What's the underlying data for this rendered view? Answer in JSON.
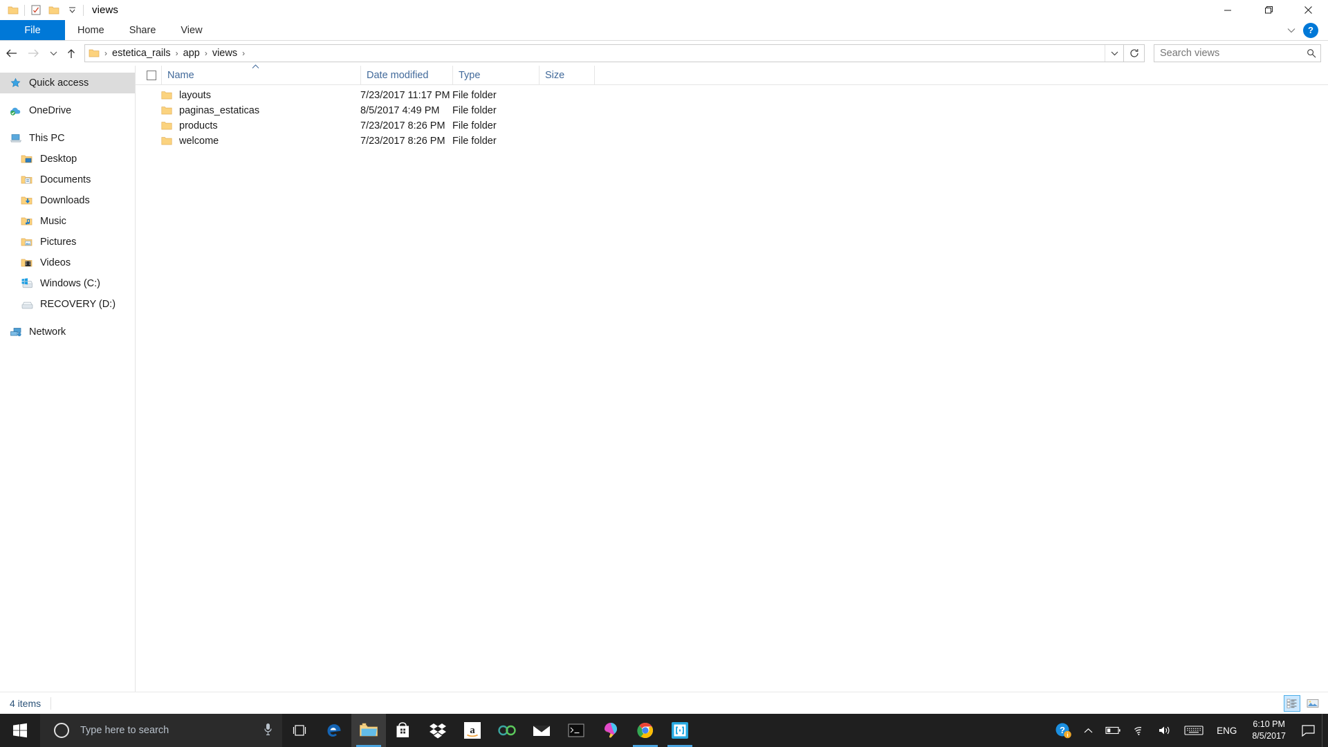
{
  "window": {
    "title": "views",
    "quick_access_icons": [
      "folder-icon",
      "properties-icon",
      "new-folder-icon",
      "customize-dropdown-icon"
    ],
    "controls": {
      "minimize": "minimize-button",
      "maximize": "maximize-button",
      "close": "close-button"
    }
  },
  "ribbon": {
    "tabs": [
      {
        "label": "File",
        "active": true
      },
      {
        "label": "Home",
        "active": false
      },
      {
        "label": "Share",
        "active": false
      },
      {
        "label": "View",
        "active": false
      }
    ],
    "expand_label": "∨",
    "help_label": "?"
  },
  "address": {
    "back": "←",
    "forward": "→",
    "recent": "∨",
    "up": "↑",
    "breadcrumbs": [
      "estetica_rails",
      "app",
      "views"
    ],
    "separator": "›",
    "dropdown": "∨",
    "refresh": "↻"
  },
  "search": {
    "placeholder": "Search views",
    "value": "",
    "icon": "search-icon"
  },
  "sidebar": {
    "items": [
      {
        "label": "Quick access",
        "icon": "star-pin-icon",
        "indent": 0,
        "selected": true
      },
      {
        "label": "OneDrive",
        "icon": "onedrive-cloud-icon",
        "indent": 0,
        "selected": false
      },
      {
        "label": "This PC",
        "icon": "this-pc-icon",
        "indent": 0,
        "selected": false
      },
      {
        "label": "Desktop",
        "icon": "desktop-folder-icon",
        "indent": 1,
        "selected": false
      },
      {
        "label": "Documents",
        "icon": "documents-folder-icon",
        "indent": 1,
        "selected": false
      },
      {
        "label": "Downloads",
        "icon": "downloads-folder-icon",
        "indent": 1,
        "selected": false
      },
      {
        "label": "Music",
        "icon": "music-folder-icon",
        "indent": 1,
        "selected": false
      },
      {
        "label": "Pictures",
        "icon": "pictures-folder-icon",
        "indent": 1,
        "selected": false
      },
      {
        "label": "Videos",
        "icon": "videos-folder-icon",
        "indent": 1,
        "selected": false
      },
      {
        "label": "Windows (C:)",
        "icon": "windows-drive-icon",
        "indent": 1,
        "selected": false
      },
      {
        "label": "RECOVERY (D:)",
        "icon": "drive-icon",
        "indent": 1,
        "selected": false
      },
      {
        "label": "Network",
        "icon": "network-icon",
        "indent": 0,
        "selected": false
      }
    ]
  },
  "filelist": {
    "columns": [
      {
        "label": "Name",
        "sorted": true,
        "sort_direction": "asc"
      },
      {
        "label": "Date modified",
        "sorted": false
      },
      {
        "label": "Type",
        "sorted": false
      },
      {
        "label": "Size",
        "sorted": false
      }
    ],
    "select_all_checkbox": false,
    "rows": [
      {
        "name": "layouts",
        "date": "7/23/2017 11:17 PM",
        "type": "File folder",
        "size": "",
        "icon": "folder-icon"
      },
      {
        "name": "paginas_estaticas",
        "date": "8/5/2017 4:49 PM",
        "type": "File folder",
        "size": "",
        "icon": "folder-icon"
      },
      {
        "name": "products",
        "date": "7/23/2017 8:26 PM",
        "type": "File folder",
        "size": "",
        "icon": "folder-icon"
      },
      {
        "name": "welcome",
        "date": "7/23/2017 8:26 PM",
        "type": "File folder",
        "size": "",
        "icon": "folder-icon"
      }
    ]
  },
  "statusbar": {
    "item_count": "4 items",
    "views": [
      {
        "name": "details-view",
        "active": true
      },
      {
        "name": "large-icons-view",
        "active": false
      }
    ]
  },
  "taskbar": {
    "start": "start-button",
    "search_placeholder": "Type here to search",
    "mic": "microphone-icon",
    "task_view": "task-view-icon",
    "apps": [
      {
        "name": "microsoft-edge",
        "running": false,
        "active": false
      },
      {
        "name": "file-explorer",
        "running": true,
        "active": true
      },
      {
        "name": "microsoft-store",
        "running": false,
        "active": false
      },
      {
        "name": "dropbox",
        "running": false,
        "active": false
      },
      {
        "name": "amazon",
        "running": false,
        "active": false
      },
      {
        "name": "nextcloud",
        "running": false,
        "active": false
      },
      {
        "name": "mail",
        "running": false,
        "active": false
      },
      {
        "name": "command-prompt",
        "running": false,
        "active": false
      },
      {
        "name": "paint-3d",
        "running": false,
        "active": false
      },
      {
        "name": "google-chrome",
        "running": true,
        "active": false
      },
      {
        "name": "brackets",
        "running": true,
        "active": false
      }
    ],
    "tray": {
      "help_icon": "help-notification-icon",
      "show_hidden": "chevron-up-icon",
      "battery": "battery-icon",
      "wifi": "wifi-icon",
      "volume": "volume-icon",
      "keyboard": "touch-keyboard-icon",
      "language": "ENG",
      "time": "6:10 PM",
      "date": "8/5/2017",
      "action_center": "action-center-icon"
    }
  }
}
